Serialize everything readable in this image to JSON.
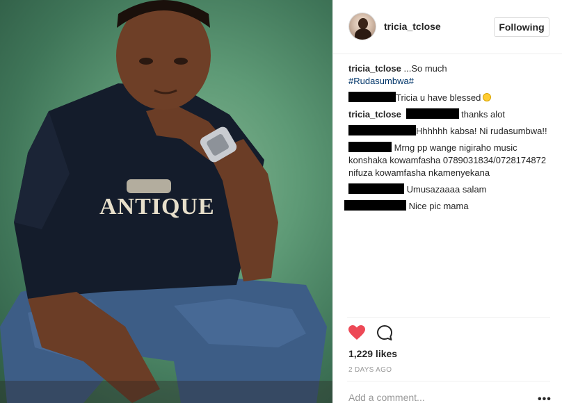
{
  "post": {
    "image_alt": "Man in navy ANTIQUE t-shirt and jeans crouching against a green backdrop",
    "shirt_print": "ANTIQUE"
  },
  "header": {
    "username": "tricia_tclose",
    "follow_label": "Following"
  },
  "comments": [
    {
      "user": "tricia_tclose",
      "text": " ...So much",
      "hashtag": "#Rudasumbwa#"
    },
    {
      "redacted": true,
      "text": "Tricia u have blessed"
    },
    {
      "user": "tricia_tclose",
      "redacted": true,
      "text": " thanks alot"
    },
    {
      "redacted": true,
      "text": "Hhhhhh kabsa! Ni rudasumbwa!!"
    },
    {
      "redacted": true,
      "text": " Mrng pp wange nigiraho music konshaka kowamfasha 0789031834/0728174872 nifuza kowamfasha nkamenyekana"
    },
    {
      "redacted": true,
      "text": " Umusazaaaa salam"
    },
    {
      "redacted": true,
      "text": " Nice pic mama"
    }
  ],
  "actions": {
    "like_icon": "heart-icon",
    "comment_icon": "comment-bubble-icon",
    "liked": true,
    "like_color": "#ed4956"
  },
  "likes": "1,229 likes",
  "timestamp": "2 DAYS AGO",
  "comment_box": {
    "placeholder": "Add a comment...",
    "more_label": "•••"
  }
}
